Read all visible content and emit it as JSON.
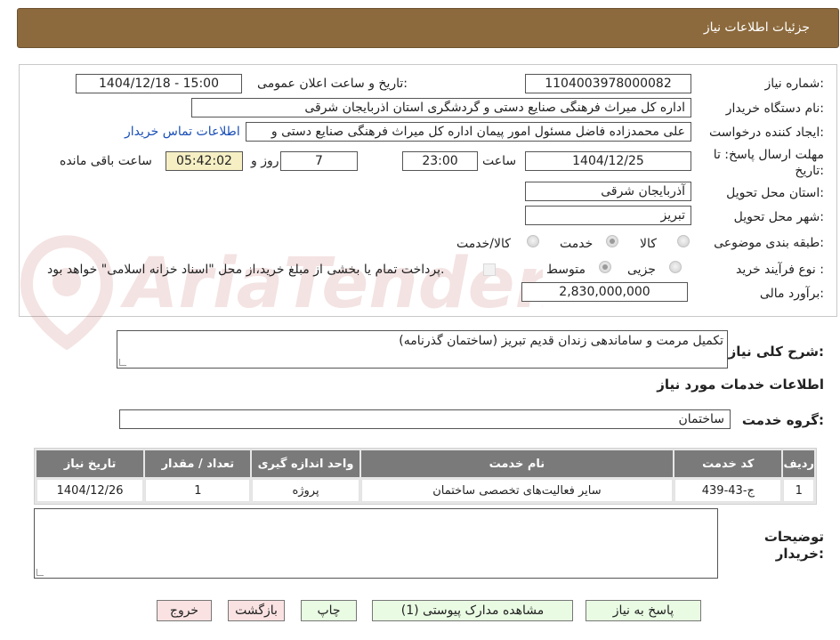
{
  "header": {
    "title": "جزئیات اطلاعات نیاز"
  },
  "form": {
    "need_number_label": "شماره نیاز:",
    "need_number": "1104003978000082",
    "announce_label": "تاریخ و ساعت اعلان عمومی:",
    "announce_value": "1404/12/18 - 15:00",
    "buyer_org_label": "نام دستگاه خریدار:",
    "buyer_org": "اداره کل میراث فرهنگی  صنایع دستی و گردشگری استان اذربایجان شرقی",
    "requester_label": "ایجاد کننده درخواست:",
    "requester": "علی محمدزاده فاضل مسئول امور پیمان اداره کل میراث فرهنگی  صنایع دستی و",
    "contact_link": "اطلاعات تماس خریدار",
    "deadline_label_1": "مهلت ارسال پاسخ: تا",
    "deadline_label_2": "تاریخ:",
    "deadline_date": "1404/12/25",
    "hour_label": "ساعت",
    "deadline_time": "23:00",
    "days_value": "7",
    "days_label": "روز و",
    "remaining_time": "05:42:02",
    "remaining_label": "ساعت باقی مانده",
    "province_label": "استان محل تحویل:",
    "province": "آذربایجان شرقی",
    "city_label": "شهر محل تحویل:",
    "city": "تبریز",
    "category_label": "طبقه بندی موضوعی:",
    "category_options": [
      "کالا",
      "خدمت",
      "کالا/خدمت"
    ],
    "category_selected": "خدمت",
    "process_label": "نوع فرآیند خرید :",
    "process_options": [
      "جزیی",
      "متوسط"
    ],
    "process_selected": "متوسط",
    "payment_note": "پرداخت تمام یا بخشی از مبلغ خرید،از محل \"اسناد خزانه اسلامی\" خواهد بود.",
    "budget_label": "برآورد مالی:",
    "budget": "2,830,000,000"
  },
  "summary": {
    "label": "شرح کلی نیاز:",
    "text": "تکمیل مرمت و ساماندهی زندان قدیم تبریز (ساختمان گذرنامه)"
  },
  "services": {
    "section_title": "اطلاعات خدمات مورد نیاز",
    "group_label": "گروه خدمت:",
    "group_value": "ساختمان",
    "columns": [
      "ردیف",
      "کد خدمت",
      "نام خدمت",
      "واحد اندازه گیری",
      "تعداد / مقدار",
      "تاریخ نیاز"
    ],
    "rows": [
      {
        "index": "1",
        "code": "ج-43-439",
        "name": "سایر فعالیت‌های تخصصی ساختمان",
        "unit": "پروژه",
        "qty": "1",
        "date": "1404/12/26"
      }
    ]
  },
  "buyer_notes": {
    "label_1": "توضیحات",
    "label_2": "خریدار:",
    "text": ""
  },
  "buttons": {
    "reply": "پاسخ به نیاز",
    "attachments": "مشاهده مدارک پیوستی (1)",
    "print": "چاپ",
    "back": "بازگشت",
    "exit": "خروج"
  },
  "watermark": {
    "text": "AriaTender.net"
  },
  "colors": {
    "header": "#8c6a3d",
    "table_header": "#7a7a7a",
    "timer_bg": "#f6efc4",
    "link": "#1a4fb8",
    "green_btn": "#e9fbe3",
    "red_btn": "#fbe2e2"
  }
}
